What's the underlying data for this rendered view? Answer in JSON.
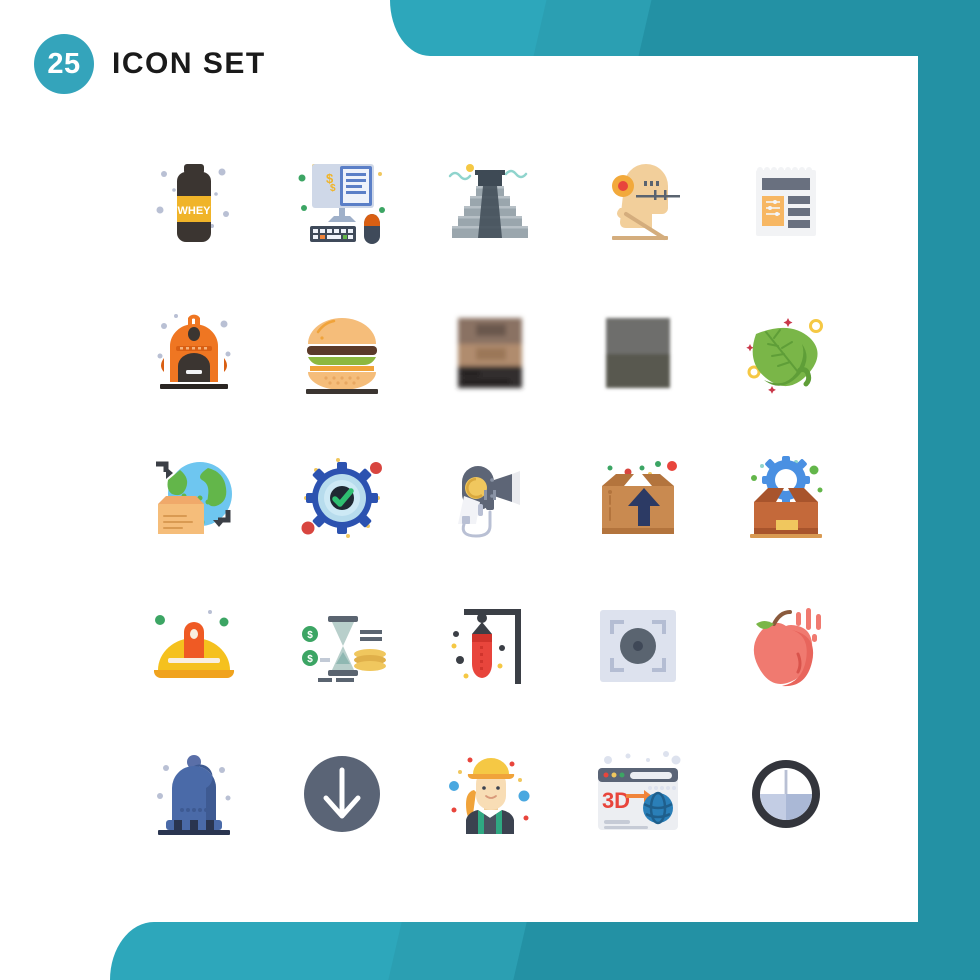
{
  "header": {
    "count": "25",
    "title": "ICON SET"
  },
  "theme": {
    "banner_light": "#2da7bb",
    "banner_mid": "#2b9fb2",
    "banner_dark": "#2391a4",
    "badge_color": "#34a4bb",
    "title_color": "#1a1a1a",
    "background": "#ffffff"
  },
  "grid": {
    "columns": 5,
    "rows": 5,
    "total": 25
  },
  "icons": [
    {
      "index": 1,
      "name": "whey-protein-bottle-icon",
      "label": "Whey Protein Supplement",
      "row": 1,
      "col": 1,
      "colors": [
        "#3b3531",
        "#f0b429",
        "#ffffff",
        "#b9c0d4"
      ]
    },
    {
      "index": 2,
      "name": "online-banking-icon",
      "label": "Online Banking Computer",
      "row": 1,
      "col": 2,
      "colors": [
        "#5b7fc7",
        "#cfd8e8",
        "#f0b429",
        "#3f4a5a"
      ]
    },
    {
      "index": 3,
      "name": "pyramid-temple-icon",
      "label": "Mayan Pyramid Temple",
      "row": 1,
      "col": 3,
      "colors": [
        "#9aa6ad",
        "#3e4a55",
        "#f5c844",
        "#8fd4cd"
      ]
    },
    {
      "index": 4,
      "name": "acupuncture-head-icon",
      "label": "Acupuncture Head Therapy",
      "row": 1,
      "col": 4,
      "colors": [
        "#f2cf9b",
        "#f2a93b",
        "#e8453c",
        "#5a6470"
      ]
    },
    {
      "index": 5,
      "name": "newspaper-article-icon",
      "label": "Newspaper Article Layout",
      "row": 1,
      "col": 5,
      "colors": [
        "#f2f3f5",
        "#69707f",
        "#f7b763"
      ]
    },
    {
      "index": 6,
      "name": "backpack-icon",
      "label": "School Backpack",
      "row": 2,
      "col": 1,
      "colors": [
        "#ef7622",
        "#d95f13",
        "#3b3531",
        "#b9c0d4"
      ]
    },
    {
      "index": 7,
      "name": "hamburger-icon",
      "label": "Hamburger Burger",
      "row": 2,
      "col": 2,
      "colors": [
        "#f5bd7a",
        "#5a3a2a",
        "#8cb83f",
        "#3b3531"
      ]
    },
    {
      "index": 8,
      "name": "blurred-stack-square-icon",
      "label": "Blurred Layered Square",
      "row": 2,
      "col": 3,
      "colors": [
        "#8a7264",
        "#b08c6e",
        "#332f2d"
      ]
    },
    {
      "index": 9,
      "name": "blurred-gray-square-icon",
      "label": "Blurred Gray Square",
      "row": 2,
      "col": 4,
      "colors": [
        "#6e6e6c",
        "#58584f"
      ]
    },
    {
      "index": 10,
      "name": "leaf-icon",
      "label": "Green Leaf",
      "row": 2,
      "col": 5,
      "colors": [
        "#7ab648",
        "#5f9e38",
        "#f5c844",
        "#c9384a"
      ]
    },
    {
      "index": 11,
      "name": "global-delivery-icon",
      "label": "Global Package Delivery",
      "row": 3,
      "col": 1,
      "colors": [
        "#6ec6f0",
        "#63b64a",
        "#f5bd7a",
        "#3b3f46"
      ]
    },
    {
      "index": 12,
      "name": "gear-check-icon",
      "label": "Settings Verified Gear",
      "row": 3,
      "col": 2,
      "colors": [
        "#2c52b0",
        "#2fbf71",
        "#1f2933",
        "#d8453f"
      ]
    },
    {
      "index": 13,
      "name": "hair-dryer-icon",
      "label": "Hair Dryer Appliance",
      "row": 3,
      "col": 3,
      "colors": [
        "#5d6576",
        "#f0c75e",
        "#e9eaee",
        "#ffffff"
      ]
    },
    {
      "index": 14,
      "name": "open-box-upload-icon",
      "label": "Open Box Upload",
      "row": 3,
      "col": 4,
      "colors": [
        "#c98a50",
        "#b3743d",
        "#2c3a64",
        "#d8453f"
      ]
    },
    {
      "index": 15,
      "name": "box-gear-icon",
      "label": "Package Settings Box",
      "row": 3,
      "col": 5,
      "colors": [
        "#c4693a",
        "#a8542c",
        "#4a90e2",
        "#63b64a"
      ]
    },
    {
      "index": 16,
      "name": "safety-helmet-icon",
      "label": "Miner Safety Helmet",
      "row": 4,
      "col": 1,
      "colors": [
        "#f5c11e",
        "#f0a31e",
        "#ef5a24",
        "#3ca564"
      ]
    },
    {
      "index": 17,
      "name": "hourglass-money-icon",
      "label": "Time Is Money Hourglass",
      "row": 4,
      "col": 2,
      "colors": [
        "#b8cfcb",
        "#5a6470",
        "#f0c75e",
        "#3ca564"
      ]
    },
    {
      "index": 18,
      "name": "punching-bag-icon",
      "label": "Boxing Punching Bag",
      "row": 4,
      "col": 3,
      "colors": [
        "#e8453c",
        "#d0342c",
        "#3b3f46",
        "#f5c844"
      ]
    },
    {
      "index": 19,
      "name": "camera-focus-icon",
      "label": "Camera Lens Focus",
      "row": 4,
      "col": 4,
      "colors": [
        "#dde2ee",
        "#5a6470",
        "#3f4857"
      ]
    },
    {
      "index": 20,
      "name": "peach-fruit-icon",
      "label": "Peach Fruit",
      "row": 4,
      "col": 5,
      "colors": [
        "#f07a70",
        "#e8655c",
        "#7ab648",
        "#8a5a3c"
      ]
    },
    {
      "index": 21,
      "name": "alarm-bell-icon",
      "label": "Alarm Bell Siren",
      "row": 5,
      "col": 1,
      "colors": [
        "#4a6aa8",
        "#3e5a92",
        "#2a3550",
        "#b9c0d4"
      ]
    },
    {
      "index": 22,
      "name": "download-arrow-icon",
      "label": "Download Arrow Circle",
      "row": 5,
      "col": 2,
      "colors": [
        "#5a6476",
        "#ffffff"
      ]
    },
    {
      "index": 23,
      "name": "female-worker-icon",
      "label": "Female Construction Worker",
      "row": 5,
      "col": 3,
      "colors": [
        "#f5c844",
        "#f0a33a",
        "#3b4250",
        "#4aa8e0"
      ]
    },
    {
      "index": 24,
      "name": "3d-browser-icon",
      "label": "3D Web Browser Window",
      "row": 5,
      "col": 4,
      "colors": [
        "#e8453c",
        "#f0843a",
        "#2a7fb8",
        "#eceef2"
      ]
    },
    {
      "index": 25,
      "name": "pie-timer-icon",
      "label": "Pie Chart Timer",
      "row": 5,
      "col": 5,
      "colors": [
        "#33353c",
        "#ffffff",
        "#c3cde4",
        "#aab8d6"
      ]
    }
  ]
}
